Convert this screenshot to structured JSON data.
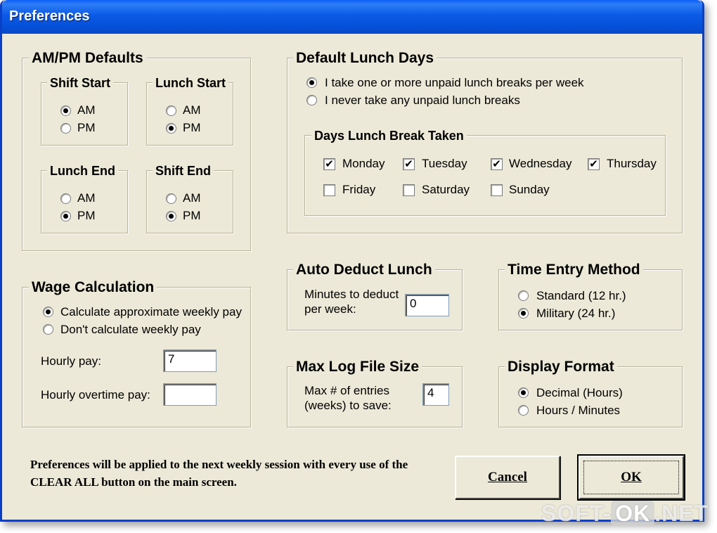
{
  "window": {
    "title": "Preferences"
  },
  "ampm": {
    "title": "AM/PM Defaults",
    "shift_start": {
      "title": "Shift Start",
      "am": "AM",
      "pm": "PM",
      "selected": "AM"
    },
    "lunch_start": {
      "title": "Lunch Start",
      "am": "AM",
      "pm": "PM",
      "selected": "PM"
    },
    "lunch_end": {
      "title": "Lunch End",
      "am": "AM",
      "pm": "PM",
      "selected": "PM"
    },
    "shift_end": {
      "title": "Shift End",
      "am": "AM",
      "pm": "PM",
      "selected": "PM"
    }
  },
  "lunch_days": {
    "title": "Default Lunch Days",
    "option_take": "I take one or more unpaid lunch breaks per week",
    "option_never": "I never take any unpaid lunch breaks",
    "selected": "take",
    "days_title": "Days Lunch Break Taken",
    "days": [
      {
        "label": "Monday",
        "checked": true
      },
      {
        "label": "Tuesday",
        "checked": true
      },
      {
        "label": "Wednesday",
        "checked": true
      },
      {
        "label": "Thursday",
        "checked": true
      },
      {
        "label": "Friday",
        "checked": false
      },
      {
        "label": "Saturday",
        "checked": false
      },
      {
        "label": "Sunday",
        "checked": false
      }
    ]
  },
  "wage": {
    "title": "Wage Calculation",
    "option_calc": "Calculate approximate weekly pay",
    "option_dont": "Don't calculate weekly pay",
    "selected": "calc",
    "hourly_label": "Hourly pay:",
    "hourly_value": "7",
    "overtime_label": "Hourly overtime pay:",
    "overtime_value": ""
  },
  "auto_deduct": {
    "title": "Auto Deduct Lunch",
    "label_line1": "Minutes to deduct",
    "label_line2": "per week:",
    "value": "0"
  },
  "time_entry": {
    "title": "Time Entry Method",
    "option_standard": "Standard (12 hr.)",
    "option_military": "Military (24 hr.)",
    "selected": "military"
  },
  "max_log": {
    "title": "Max Log File Size",
    "label_line1": "Max # of entries",
    "label_line2": "(weeks) to save:",
    "value": "4"
  },
  "display_format": {
    "title": "Display Format",
    "option_decimal": "Decimal (Hours)",
    "option_hm": "Hours / Minutes",
    "selected": "decimal"
  },
  "footer": {
    "note": "Preferences will be applied to the next weekly session with every use of the CLEAR ALL button on the main screen.",
    "cancel_label": "Cancel",
    "ok_label": "OK"
  },
  "watermark": {
    "part1": "SOFT-",
    "part2": "OK",
    "part3": ".NET"
  },
  "colors": {
    "title_bar": "#0a5df8",
    "dialog_bg": "#ece9d8",
    "frame_border": "#0a3fc8"
  }
}
